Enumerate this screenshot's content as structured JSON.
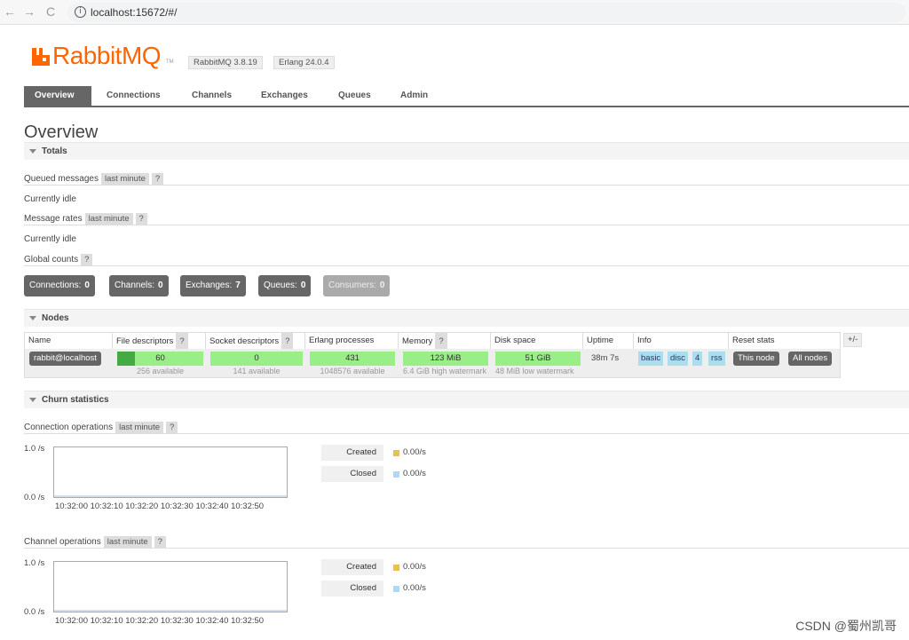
{
  "browser": {
    "url": "localhost:15672/#/",
    "back_glyph": "←",
    "forward_glyph": "→",
    "reload_glyph": "C",
    "info_glyph": "i"
  },
  "header": {
    "brand": "RabbitMQ",
    "tm": "TM",
    "rabbitmq_version": "RabbitMQ 3.8.19",
    "erlang_version": "Erlang 24.0.4",
    "brand_color": "#ff6600"
  },
  "tabs": [
    {
      "label": "Overview"
    },
    {
      "label": "Connections"
    },
    {
      "label": "Channels"
    },
    {
      "label": "Exchanges"
    },
    {
      "label": "Queues"
    },
    {
      "label": "Admin"
    }
  ],
  "page_title": "Overview",
  "totals": {
    "section": "Totals",
    "queued_label": "Queued messages",
    "queued_pill": "last minute",
    "queued_help": "?",
    "idle_1": "Currently idle",
    "rates_label": "Message rates",
    "rates_pill": "last minute",
    "rates_help": "?",
    "idle_2": "Currently idle",
    "global_label": "Global counts",
    "global_help": "?",
    "counts": [
      {
        "label": "Connections:",
        "value": "0"
      },
      {
        "label": "Channels:",
        "value": "0"
      },
      {
        "label": "Exchanges:",
        "value": "7"
      },
      {
        "label": "Queues:",
        "value": "0"
      },
      {
        "label": "Consumers:",
        "value": "0"
      }
    ]
  },
  "nodes": {
    "section": "Nodes",
    "columns": {
      "name": "Name",
      "fd": "File descriptors",
      "sd": "Socket descriptors",
      "ep": "Erlang processes",
      "mem": "Memory",
      "disk": "Disk space",
      "uptime": "Uptime",
      "info": "Info",
      "reset": "Reset stats"
    },
    "help": "?",
    "plusminus": "+/-",
    "row": {
      "name": "rabbit@localhost",
      "fd": "60",
      "fd_avail": "256 available",
      "sd": "0",
      "sd_avail": "141 available",
      "ep": "431",
      "ep_avail": "1048576 available",
      "mem": "123 MiB",
      "mem_watermark": "6.4 GiB high watermark",
      "disk": "51 GiB",
      "disk_watermark": "48 MiB low watermark",
      "uptime": "38m 7s",
      "info_tags": [
        "basic",
        "disc",
        "4",
        "rss"
      ],
      "btn_this_node": "This node",
      "btn_all_nodes": "All nodes"
    }
  },
  "churn": {
    "section": "Churn statistics",
    "conn_label": "Connection operations",
    "conn_pill": "last minute",
    "conn_help": "?",
    "chan_label": "Channel operations",
    "chan_pill": "last minute",
    "chan_help": "?",
    "y_top": "1.0 /s",
    "y_bottom": "0.0 /s",
    "x_ticks": "10:32:00 10:32:10 10:32:20 10:32:30 10:32:40 10:32:50",
    "legend": [
      {
        "name": "Created",
        "value": "0.00/s",
        "color": "#edc240"
      },
      {
        "name": "Closed",
        "value": "0.00/s",
        "color": "#afd8f8"
      }
    ]
  },
  "watermark": "CSDN @蜀州凯哥"
}
